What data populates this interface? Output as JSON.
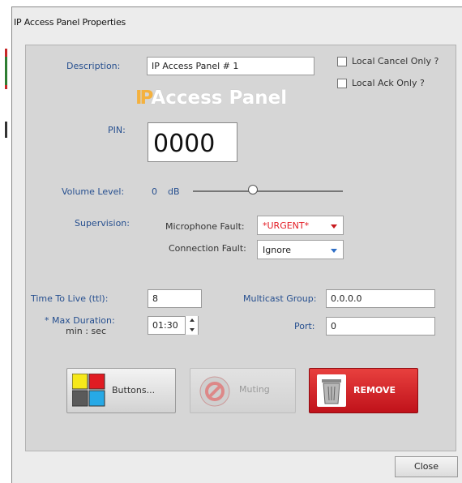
{
  "window": {
    "title": "IP Access Panel Properties"
  },
  "brand": {
    "ip": "IP",
    "rest": "Access Panel"
  },
  "description": {
    "label": "Description:",
    "value": "IP Access Panel # 1"
  },
  "options": {
    "local_cancel_label": "Local Cancel Only ?",
    "local_ack_label": "Local Ack Only ?",
    "local_cancel_checked": false,
    "local_ack_checked": false
  },
  "pin": {
    "label": "PIN:",
    "value": "0000"
  },
  "volume": {
    "label": "Volume Level:",
    "value": "0",
    "unit": "dB",
    "slider_level_fraction": 0.37
  },
  "supervision": {
    "label": "Supervision:",
    "microphone_fault_label": "Microphone Fault:",
    "microphone_fault_value": "*URGENT*",
    "connection_fault_label": "Connection Fault:",
    "connection_fault_value": "Ignore"
  },
  "network": {
    "ttl_label": "Time To Live (ttl):",
    "ttl_value": "8",
    "max_duration_label": "* Max Duration:",
    "max_duration_sub": "min : sec",
    "max_duration_value": "01:30",
    "multicast_label": "Multicast Group:",
    "multicast_value": "0.0.0.0",
    "port_label": "Port:",
    "port_value": "0"
  },
  "actions": {
    "buttons_label": "Buttons...",
    "muting_label": "Muting",
    "remove_label": "REMOVE",
    "close_label": "Close"
  },
  "colors": {
    "label_blue": "#264f8f",
    "urgent_red": "#e31b23",
    "remove_red": "#c81a1f",
    "brand_orange": "#f4b13e"
  }
}
